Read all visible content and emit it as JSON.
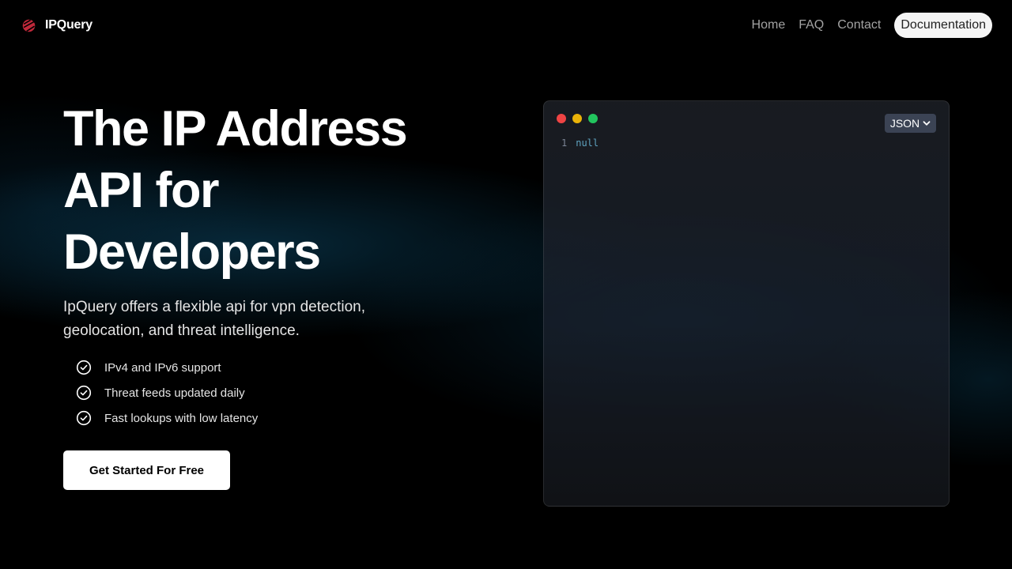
{
  "brand": {
    "name": "IPQuery",
    "logo_icon": "logo-icon",
    "logo_color": "#c0283a"
  },
  "nav": {
    "links": [
      "Home",
      "FAQ",
      "Contact"
    ],
    "doc_button": "Documentation"
  },
  "hero": {
    "title_lines": [
      "The IP Address",
      "API for",
      "Developers"
    ],
    "subtitle": "IpQuery offers a flexible api for vpn detection, geolocation, and threat intelligence.",
    "features": [
      "IPv4 and IPv6 support",
      "Threat feeds updated daily",
      "Fast lookups with low latency"
    ],
    "feature_icon": "check-circle-icon",
    "cta": "Get Started For Free"
  },
  "code_window": {
    "format_selected": "JSON",
    "lines": [
      {
        "number": "1",
        "code": "null"
      }
    ],
    "dot_colors": [
      "#ef4444",
      "#eab308",
      "#22c55e"
    ]
  }
}
